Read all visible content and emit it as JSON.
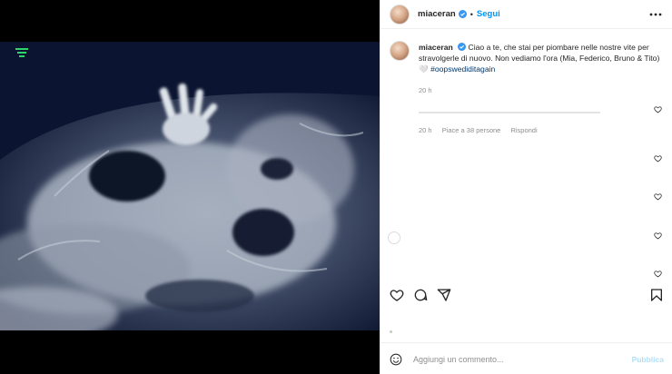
{
  "post": {
    "username": "miaceran",
    "follow_label": "Segui",
    "separator": "•"
  },
  "caption": {
    "username": "miaceran",
    "text": "Ciao a te, che stai per piombare nelle nostre vite per stravolgerle di nuovo. Non vediamo l'ora (Mia, Federico, Bruno & Tito) 🤍",
    "hashtag": "#oopswediditagain",
    "time": "20 h"
  },
  "comment_meta": {
    "time": "20 h",
    "likes": "Piace a 38 persone",
    "reply": "Rispondi"
  },
  "add_comment": {
    "placeholder": "Aggiungi un commento...",
    "publish": "Pubblica"
  },
  "icons": {
    "verified": "verified-badge-icon",
    "more": "more-options-icon",
    "like": "heart-icon",
    "comment": "comment-icon",
    "share": "share-icon",
    "save": "bookmark-icon",
    "emoji": "emoji-icon"
  },
  "colors": {
    "accent": "#0095f6",
    "text": "#262626",
    "muted": "#8e8e8e"
  }
}
